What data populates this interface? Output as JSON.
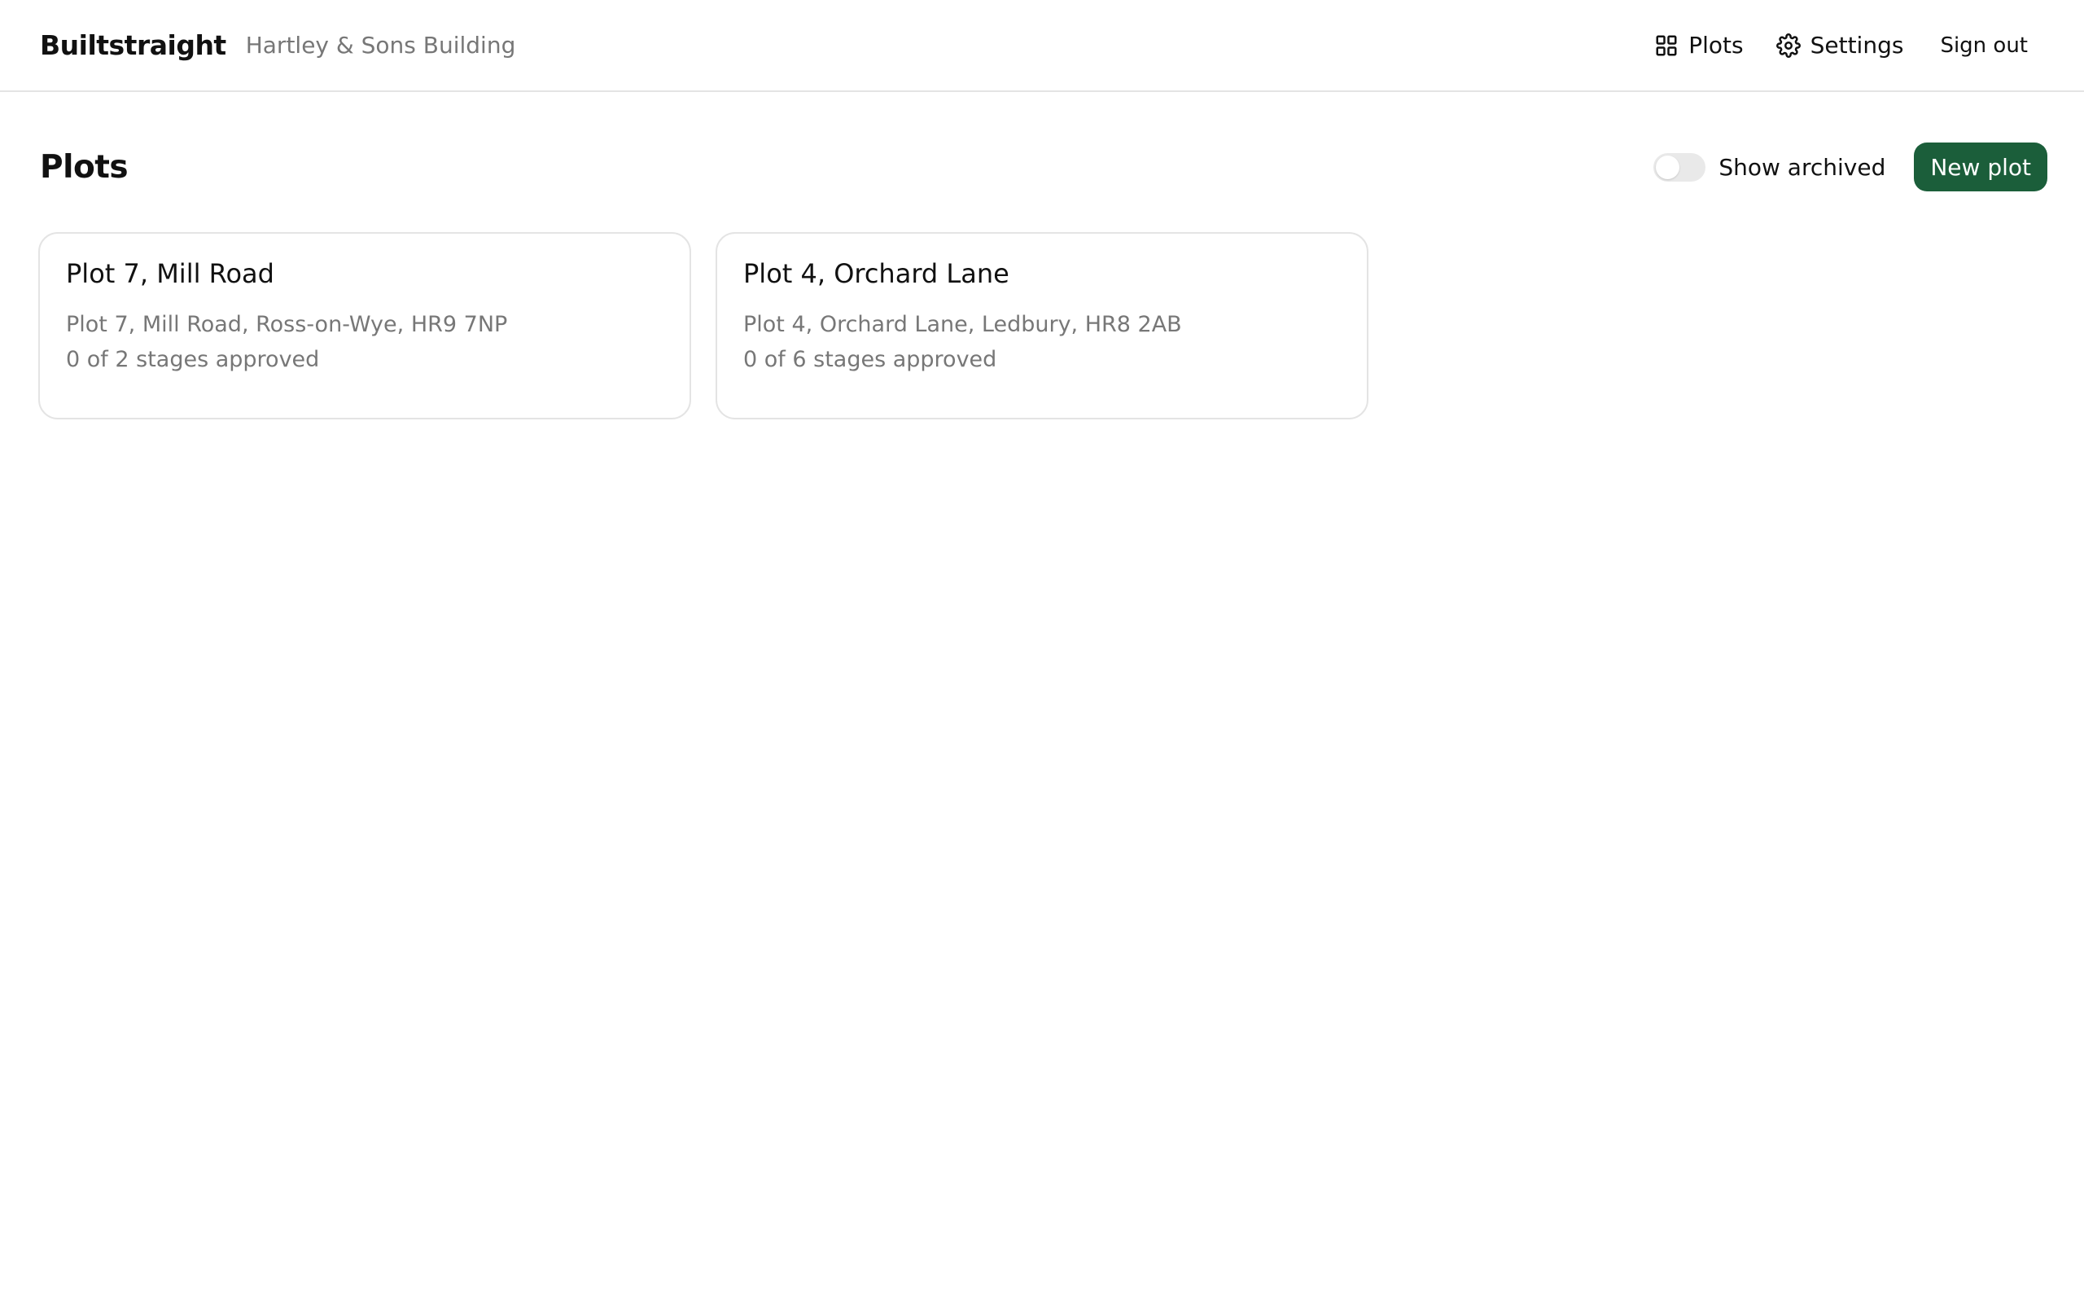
{
  "app": {
    "brand": "Builtstraight",
    "organization": "Hartley & Sons Building"
  },
  "nav": {
    "plots": {
      "label": "Plots",
      "icon": "grid-icon"
    },
    "settings": {
      "label": "Settings",
      "icon": "gear-icon"
    },
    "sign_out": {
      "label": "Sign out"
    }
  },
  "page": {
    "title": "Plots",
    "show_archived_label": "Show archived",
    "show_archived_on": false,
    "new_plot_label": "New plot"
  },
  "plots": [
    {
      "name": "Plot 7, Mill Road",
      "address": "Plot 7, Mill Road, Ross-on-Wye, HR9 7NP",
      "progress": "0 of 2 stages approved"
    },
    {
      "name": "Plot 4, Orchard Lane",
      "address": "Plot 4, Orchard Lane, Ledbury, HR8 2AB",
      "progress": "0 of 6 stages approved"
    }
  ],
  "colors": {
    "accent": "#1b5e3a",
    "muted_text": "#777777",
    "border": "#e4e4e4"
  }
}
